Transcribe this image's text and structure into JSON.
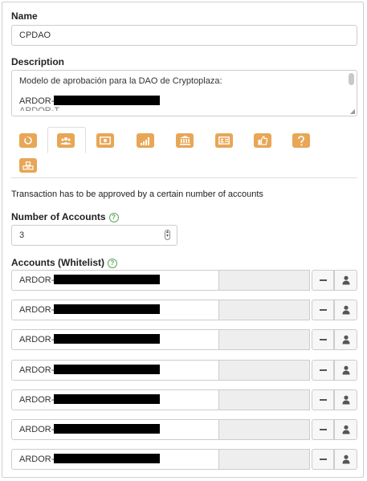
{
  "name": {
    "label": "Name",
    "value": "CPDAO"
  },
  "description": {
    "label": "Description",
    "line1": "Modelo de aprobación para la DAO de Cryptoplaza:",
    "line2_prefix": "ARDOR-",
    "line3_partial": "ARDOR-T..."
  },
  "tabs": [
    {
      "icon": "coin-icon"
    },
    {
      "icon": "users-icon",
      "active": true
    },
    {
      "icon": "money-bill-icon"
    },
    {
      "icon": "signal-bars-icon"
    },
    {
      "icon": "bank-icon"
    },
    {
      "icon": "id-card-icon"
    },
    {
      "icon": "thumbs-up-icon"
    },
    {
      "icon": "question-icon"
    },
    {
      "icon": "cubes-icon"
    }
  ],
  "info_text": "Transaction has to be approved by a certain number of accounts",
  "num_accounts": {
    "label": "Number of Accounts",
    "value": "3"
  },
  "accounts": {
    "label": "Accounts (Whitelist)",
    "rows": [
      {
        "prefix": "ARDOR-"
      },
      {
        "prefix": "ARDOR-"
      },
      {
        "prefix": "ARDOR-"
      },
      {
        "prefix": "ARDOR-"
      },
      {
        "prefix": "ARDOR-"
      },
      {
        "prefix": "ARDOR-"
      },
      {
        "prefix": "ARDOR-"
      }
    ]
  },
  "colors": {
    "tab_orange": "#e8a656",
    "help_green": "#5aa65a",
    "redaction": "#000000"
  }
}
